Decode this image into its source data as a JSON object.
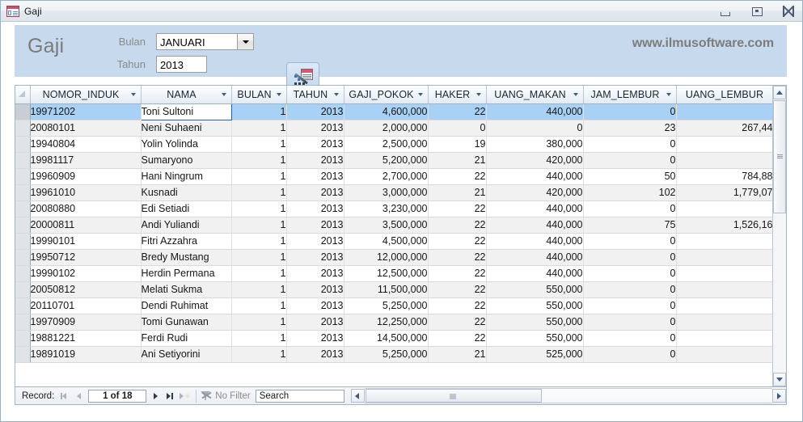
{
  "window": {
    "title": "Gaji",
    "icon": "form-icon",
    "controls": {
      "minimize": "Minimize",
      "restore": "Restore",
      "close": "Close"
    }
  },
  "form_header": {
    "title": "Gaji",
    "watermark": "www.ilmusoftware.com",
    "fields": [
      {
        "label": "Bulan",
        "value": "JANUARI",
        "type": "combobox"
      },
      {
        "label": "Tahun",
        "value": "2013",
        "type": "textbox"
      }
    ],
    "action_button": {
      "icon": "report-wizard-icon",
      "tooltip": ""
    },
    "background": "#c6d9ed"
  },
  "datasheet": {
    "columns": [
      {
        "key": "nomor_induk",
        "label": "NOMOR_INDUK",
        "align": "left",
        "sortable": true
      },
      {
        "key": "nama",
        "label": "NAMA",
        "align": "left",
        "sortable": true
      },
      {
        "key": "bulan",
        "label": "BULAN",
        "align": "right",
        "sortable": true
      },
      {
        "key": "tahun",
        "label": "TAHUN",
        "align": "right",
        "sortable": true
      },
      {
        "key": "gaji_pokok",
        "label": "GAJI_POKOK",
        "align": "right",
        "sortable": true
      },
      {
        "key": "haker",
        "label": "HAKER",
        "align": "right",
        "sortable": true
      },
      {
        "key": "uang_makan",
        "label": "UANG_MAKAN",
        "align": "right",
        "sortable": true
      },
      {
        "key": "jam_lembur",
        "label": "JAM_LEMBUR",
        "align": "right",
        "sortable": true
      },
      {
        "key": "uang_lembur",
        "label": "UANG_LEMBUR",
        "align": "right",
        "sortable": false
      }
    ],
    "rows": [
      {
        "nomor_induk": "19971202",
        "nama": "Toni Sultoni",
        "bulan": "1",
        "tahun": "2013",
        "gaji_pokok": "4,600,000",
        "haker": "22",
        "uang_makan": "440,000",
        "jam_lembur": "0",
        "uang_lembur": ""
      },
      {
        "nomor_induk": "20080101",
        "nama": "Neni Suhaeni",
        "bulan": "1",
        "tahun": "2013",
        "gaji_pokok": "2,000,000",
        "haker": "0",
        "uang_makan": "0",
        "jam_lembur": "23",
        "uang_lembur": "267,44"
      },
      {
        "nomor_induk": "19940804",
        "nama": "Yolin Yolinda",
        "bulan": "1",
        "tahun": "2013",
        "gaji_pokok": "2,500,000",
        "haker": "19",
        "uang_makan": "380,000",
        "jam_lembur": "0",
        "uang_lembur": ""
      },
      {
        "nomor_induk": "19981117",
        "nama": "Sumaryono",
        "bulan": "1",
        "tahun": "2013",
        "gaji_pokok": "5,200,000",
        "haker": "21",
        "uang_makan": "420,000",
        "jam_lembur": "0",
        "uang_lembur": ""
      },
      {
        "nomor_induk": "19960909",
        "nama": "Hani Ningrum",
        "bulan": "1",
        "tahun": "2013",
        "gaji_pokok": "2,700,000",
        "haker": "22",
        "uang_makan": "440,000",
        "jam_lembur": "50",
        "uang_lembur": "784,88"
      },
      {
        "nomor_induk": "19961010",
        "nama": "Kusnadi",
        "bulan": "1",
        "tahun": "2013",
        "gaji_pokok": "3,000,000",
        "haker": "21",
        "uang_makan": "420,000",
        "jam_lembur": "102",
        "uang_lembur": "1,779,07"
      },
      {
        "nomor_induk": "20080880",
        "nama": "Edi Setiadi",
        "bulan": "1",
        "tahun": "2013",
        "gaji_pokok": "3,230,000",
        "haker": "22",
        "uang_makan": "440,000",
        "jam_lembur": "0",
        "uang_lembur": ""
      },
      {
        "nomor_induk": "20000811",
        "nama": "Andi Yuliandi",
        "bulan": "1",
        "tahun": "2013",
        "gaji_pokok": "3,500,000",
        "haker": "22",
        "uang_makan": "440,000",
        "jam_lembur": "75",
        "uang_lembur": "1,526,16"
      },
      {
        "nomor_induk": "19990101",
        "nama": "Fitri Azzahra",
        "bulan": "1",
        "tahun": "2013",
        "gaji_pokok": "4,500,000",
        "haker": "22",
        "uang_makan": "440,000",
        "jam_lembur": "0",
        "uang_lembur": ""
      },
      {
        "nomor_induk": "19950712",
        "nama": "Bredy Mustang",
        "bulan": "1",
        "tahun": "2013",
        "gaji_pokok": "12,000,000",
        "haker": "22",
        "uang_makan": "440,000",
        "jam_lembur": "0",
        "uang_lembur": ""
      },
      {
        "nomor_induk": "19990102",
        "nama": "Herdin Permana",
        "bulan": "1",
        "tahun": "2013",
        "gaji_pokok": "12,500,000",
        "haker": "22",
        "uang_makan": "440,000",
        "jam_lembur": "0",
        "uang_lembur": ""
      },
      {
        "nomor_induk": "20050812",
        "nama": "Melati Sukma",
        "bulan": "1",
        "tahun": "2013",
        "gaji_pokok": "11,500,000",
        "haker": "22",
        "uang_makan": "550,000",
        "jam_lembur": "0",
        "uang_lembur": ""
      },
      {
        "nomor_induk": "20110701",
        "nama": "Dendi Ruhimat",
        "bulan": "1",
        "tahun": "2013",
        "gaji_pokok": "5,250,000",
        "haker": "22",
        "uang_makan": "550,000",
        "jam_lembur": "0",
        "uang_lembur": ""
      },
      {
        "nomor_induk": "19970909",
        "nama": "Tomi Gunawan",
        "bulan": "1",
        "tahun": "2013",
        "gaji_pokok": "12,250,000",
        "haker": "22",
        "uang_makan": "550,000",
        "jam_lembur": "0",
        "uang_lembur": ""
      },
      {
        "nomor_induk": "19881221",
        "nama": "Ferdi Rudi",
        "bulan": "1",
        "tahun": "2013",
        "gaji_pokok": "14,500,000",
        "haker": "22",
        "uang_makan": "550,000",
        "jam_lembur": "0",
        "uang_lembur": ""
      },
      {
        "nomor_induk": "19891019",
        "nama": "Ani Setiyorini",
        "bulan": "1",
        "tahun": "2013",
        "gaji_pokok": "5,250,000",
        "haker": "21",
        "uang_makan": "525,000",
        "jam_lembur": "0",
        "uang_lembur": ""
      }
    ],
    "selected_row_index": 0,
    "selected_cell_column": "nama"
  },
  "navbar": {
    "record_label": "Record:",
    "record_position": "1 of 18",
    "first_label": "First record",
    "previous_label": "Previous record",
    "next_label": "Next record",
    "last_label": "Last record",
    "new_label": "New (blank) record",
    "filter_status": "No Filter",
    "search_value": "Search"
  }
}
